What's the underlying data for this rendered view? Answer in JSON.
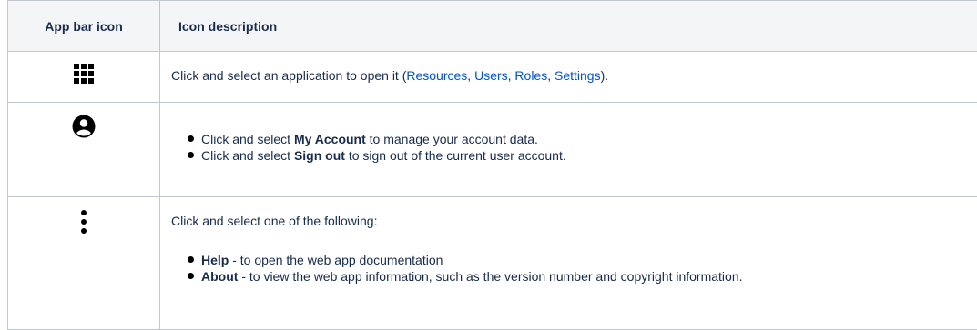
{
  "header": {
    "icon_col": "App bar icon",
    "desc_col": "Icon description"
  },
  "rows": {
    "apps": {
      "icon": "apps-grid-icon",
      "text_before": "Click and select an application to open it (",
      "links": [
        "Resources",
        "Users",
        "Roles",
        "Settings"
      ],
      "sep": ", ",
      "text_after": ")."
    },
    "account": {
      "icon": "account-circle-icon",
      "bullets": [
        {
          "pre": "Click and select ",
          "bold": "My Account",
          "post": " to manage your account data."
        },
        {
          "pre": "Click and select ",
          "bold": "Sign out",
          "post": " to sign out of the current user account."
        }
      ]
    },
    "more": {
      "icon": "more-vertical-icon",
      "intro": "Click and select one of the following:",
      "bullets": [
        {
          "bold": "Help",
          "post": " - to open the web app documentation"
        },
        {
          "bold": "About",
          "post": " - to view the web app information, such as the version number and copyright information."
        }
      ]
    }
  },
  "colors": {
    "link": "#0052cc",
    "header_bg": "#f4f5f7",
    "border": "#c1c7d0"
  }
}
